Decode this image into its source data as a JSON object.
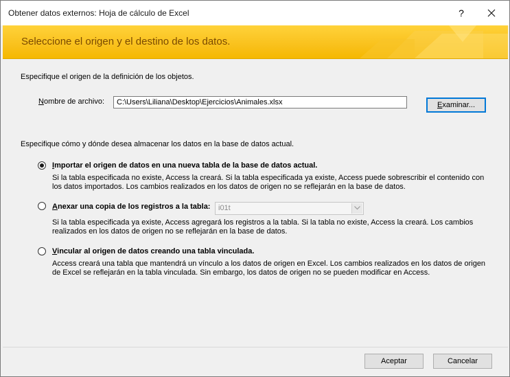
{
  "window": {
    "title": "Obtener datos externos: Hoja de cálculo de Excel",
    "help_label": "?",
    "close_label": "✕"
  },
  "banner": {
    "heading": "Seleccione el origen y el destino de los datos."
  },
  "source": {
    "instruction": "Especifique el origen de la definición de los objetos.",
    "file_label_first": "N",
    "file_label_rest": "ombre de archivo:",
    "file_value": "C:\\Users\\Liliana\\Desktop\\Ejercicios\\Animales.xlsx",
    "browse_label_first": "E",
    "browse_label_rest": "xaminar..."
  },
  "destination": {
    "instruction": "Especifique cómo y dónde desea almacenar los datos en la base de datos actual.",
    "options": [
      {
        "key_first": "I",
        "title_rest": "mportar el origen de datos en una nueva tabla de la base de datos actual.",
        "description": "Si la tabla especificada no existe, Access la creará. Si la tabla especificada ya existe, Access puede sobrescribir el contenido con los datos importados. Los cambios realizados en los datos de origen no se reflejarán en la base de datos.",
        "selected": true
      },
      {
        "key_first": "A",
        "title_rest": "nexar una copia de los registros a la tabla:",
        "table_value": "i01t",
        "description": "Si la tabla especificada ya existe, Access agregará los registros a la tabla. Si la tabla no existe, Access la creará. Los cambios realizados en los datos de origen no se reflejarán en la base de datos.",
        "selected": false
      },
      {
        "key_first": "V",
        "title_rest": "incular al origen de datos creando una tabla vinculada.",
        "description": "Access creará una tabla que mantendrá un vínculo a los datos de origen en Excel. Los cambios realizados en los datos de origen de Excel se reflejarán en la tabla vinculada. Sin embargo, los datos de origen no se pueden modificar en Access.",
        "selected": false
      }
    ]
  },
  "footer": {
    "accept_label": "Aceptar",
    "cancel_label": "Cancelar"
  },
  "colors": {
    "banner": "#f9c11c",
    "banner_text": "#7a4a00",
    "focus_border": "#0078d7"
  }
}
